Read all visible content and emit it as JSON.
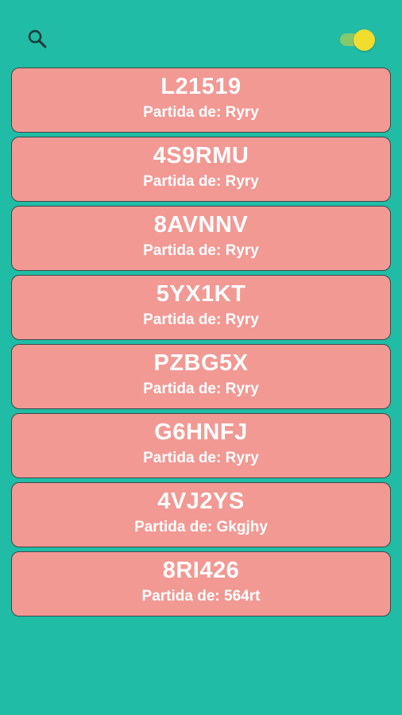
{
  "header": {
    "search_icon": "search-icon",
    "theme_toggle": {
      "state": "on",
      "track_color": "#86c96a",
      "thumb_color": "#f2dd2e"
    }
  },
  "colors": {
    "background": "#20bca6",
    "card": "#f29994",
    "card_border": "#3c4a48",
    "card_text": "#ffffff"
  },
  "games": [
    {
      "code": "L21519",
      "owner": "Partida de: Ryry"
    },
    {
      "code": "4S9RMU",
      "owner": "Partida de: Ryry"
    },
    {
      "code": "8AVNNV",
      "owner": "Partida de: Ryry"
    },
    {
      "code": "5YX1KT",
      "owner": "Partida de: Ryry"
    },
    {
      "code": "PZBG5X",
      "owner": "Partida de: Ryry"
    },
    {
      "code": "G6HNFJ",
      "owner": "Partida de: Ryry"
    },
    {
      "code": "4VJ2YS",
      "owner": "Partida de: Gkgjhy"
    },
    {
      "code": "8RI426",
      "owner": "Partida de: 564rt"
    }
  ]
}
